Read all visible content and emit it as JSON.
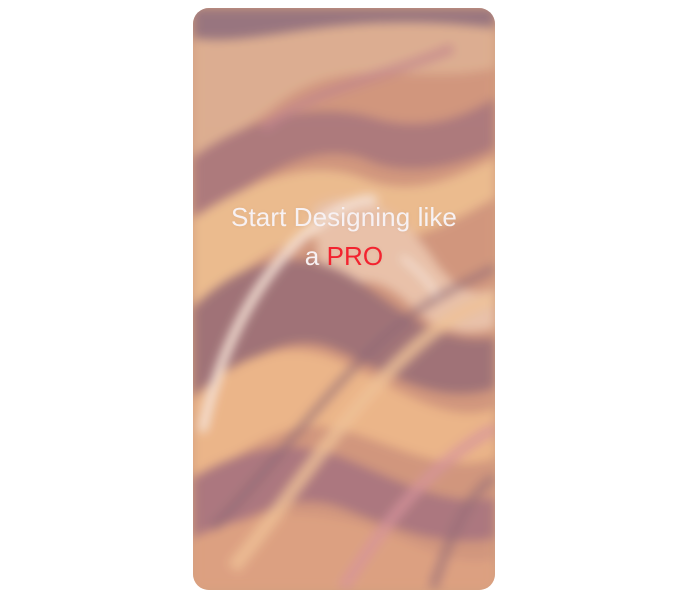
{
  "hero": {
    "headline_line1": "Start Designing like",
    "headline_prefix": "a",
    "headline_accent": "PRO"
  },
  "colors": {
    "accent": "#f3232f",
    "headline_text": "#f7f1f3",
    "page_background": "#ffffff"
  }
}
